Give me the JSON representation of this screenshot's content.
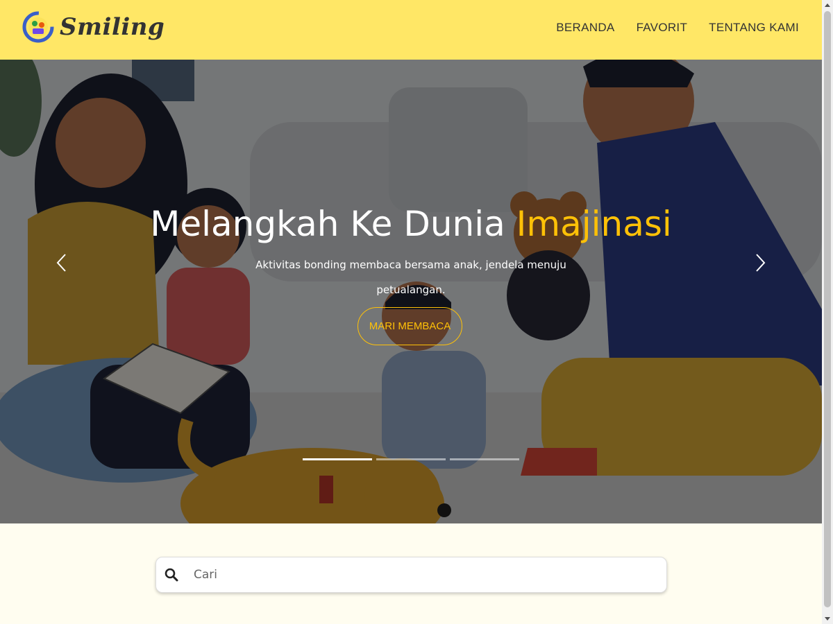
{
  "brand": {
    "name": "Smiling",
    "logo_icon": "family-reading-logo-icon"
  },
  "nav": {
    "items": [
      "BERANDA",
      "FAVORIT",
      "TENTANG KAMI"
    ]
  },
  "hero": {
    "title_main": "Melangkah Ke Dunia ",
    "title_accent": "Imajinasi",
    "subtitle": "Aktivitas bonding membaca bersama anak, jendela menuju petualangan.",
    "button_label": "MARI MEMBACA",
    "prev_icon": "chevron-left-icon",
    "next_icon": "chevron-right-icon",
    "slides_total": 3,
    "active_slide": 1,
    "accent_color": "#ffc107"
  },
  "search": {
    "placeholder": "Cari",
    "value": "",
    "icon": "search-icon"
  },
  "colors": {
    "navbar": "#ffe766",
    "page_bg": "#fffdf0"
  }
}
